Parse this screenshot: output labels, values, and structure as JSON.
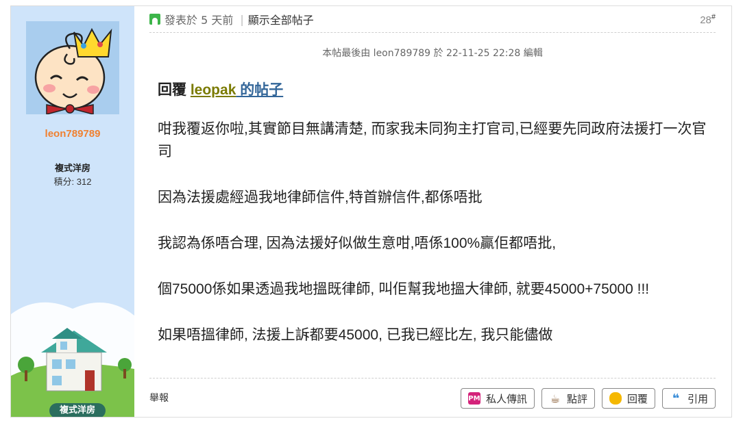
{
  "user": {
    "name": "leon789789",
    "rank": "複式洋房",
    "points": "積分: 312",
    "house_badge": "複式洋房"
  },
  "post": {
    "posted": "發表於 5 天前",
    "separator": "|",
    "show_all": "顯示全部帖子",
    "floor": "28",
    "floor_mark": "#",
    "edited": "本帖最後由 leon789789 於 22-11-25 22:28 編輯",
    "reply_prefix": "回覆 ",
    "reply_user": "leopak",
    "reply_suffix": " 的帖子",
    "paragraphs": [
      "咁我覆返你啦,其實節目無講清楚, 而家我未同狗主打官司,已經要先同政府法援打一次官司",
      "因為法援處經過我地律師信件,特首辦信件,都係唔批",
      "我認為係唔合理, 因為法援好似做生意咁,唔係100%贏佢都唔批,",
      "個75000係如果透過我地搵既律師, 叫佢幫我地搵大律師, 就要45000+75000 !!!",
      "如果唔搵律師, 法援上訴都要45000, 已我已經比左, 我只能儘做"
    ]
  },
  "footer": {
    "report": "舉報",
    "pm": "私人傳訊",
    "rate": "點評",
    "reply": "回覆",
    "quote": "引用"
  },
  "icons": {
    "pm_icon": "PM",
    "rate_icon": "☕",
    "quote_icon": "❝"
  },
  "colors": {
    "sidebar_bg": "#cfe4fa",
    "username": "#f08030",
    "reply_user": "#7a7a00",
    "reply_link": "#336699"
  }
}
